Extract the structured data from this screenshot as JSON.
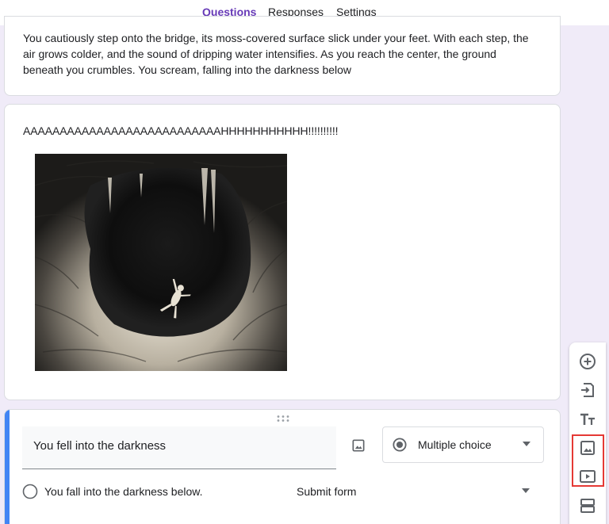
{
  "tabs": {
    "questions": "Questions",
    "responses": "Responses",
    "settings": "Settings"
  },
  "story_card": {
    "text": "You cautiously step onto the bridge, its moss-covered surface slick under your feet. With each step, the air grows colder, and the sound of dripping water intensifies. As you reach the center, the ground beneath you crumbles. You scream, falling into the darkness below"
  },
  "image_card": {
    "caption": "AAAAAAAAAAAAAAAAAAAAAAAAAAAHHHHHHHHHHH!!!!!!!!!!"
  },
  "question": {
    "title": "You fell into the darkness",
    "type_label": "Multiple choice",
    "option_label": "You fall into the darkness below.",
    "option_action": "Submit form"
  },
  "toolbar_icons": [
    "add-question-icon",
    "import-questions-icon",
    "add-title-icon",
    "add-image-icon",
    "add-video-icon",
    "add-section-icon"
  ],
  "colors": {
    "accent": "#673ab7",
    "background": "#f0ebf8",
    "active_bar": "#4285f4",
    "highlight": "#e53935"
  }
}
